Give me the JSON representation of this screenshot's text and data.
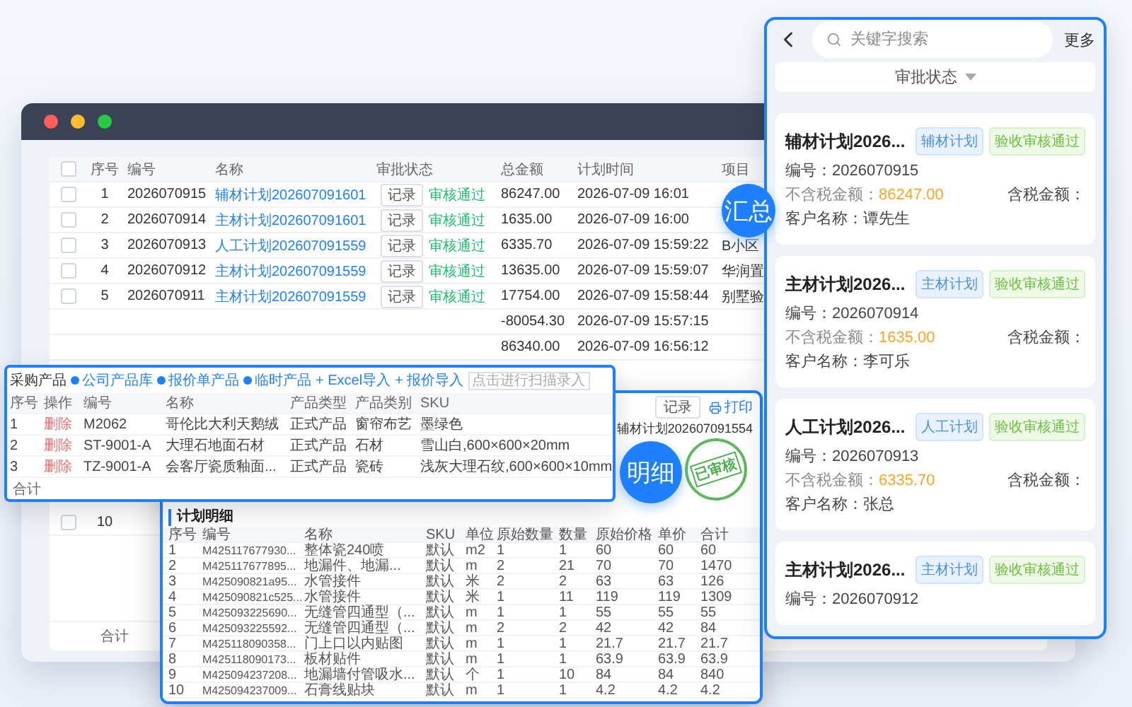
{
  "main_window": {
    "table": {
      "all_checked": false,
      "columns": [
        "序号",
        "编号",
        "名称",
        "审批状态",
        "总金额",
        "计划时间",
        "项目"
      ],
      "rows": [
        {
          "checked": false,
          "index": "1",
          "code": "2026070915",
          "name": "辅材计划202607091601",
          "record": "记录",
          "status": "审核通过",
          "amount": "86247.00",
          "time": "2026-07-09 16:01"
        },
        {
          "checked": false,
          "index": "2",
          "code": "2026070914",
          "name": "主材计划202607091601",
          "record": "记录",
          "status": "审核通过",
          "amount": "1635.00",
          "time": "2026-07-09 16:00"
        },
        {
          "checked": false,
          "index": "3",
          "code": "2026070913",
          "name": "人工计划202607091559",
          "record": "记录",
          "status": "审核通过",
          "amount": "6335.70",
          "time": "2026-07-09 15:59:22",
          "project": "B小区"
        },
        {
          "checked": false,
          "index": "4",
          "code": "2026070912",
          "name": "主材计划202607091559",
          "record": "记录",
          "status": "审核通过",
          "amount": "13635.00",
          "time": "2026-07-09 15:59:07",
          "project": "华润置"
        },
        {
          "checked": false,
          "index": "5",
          "code": "2026070911",
          "name": "主材计划202607091559",
          "record": "记录",
          "status": "审核通过",
          "amount": "17754.00",
          "time": "2026-07-09 15:58:44",
          "project": "别墅验"
        },
        {
          "amount": "-80054.30",
          "time": "2026-07-09 15:57:15"
        },
        {
          "amount": "86340.00",
          "time": "2026-07-09 16:56:12"
        }
      ],
      "last_row": {
        "checked": false,
        "index": "10"
      },
      "footer": "合计"
    }
  },
  "summary_badge": "汇总",
  "detail_badge": "明细",
  "product_popup": {
    "toolbar": [
      {
        "kind": "label",
        "text": "采购产品"
      },
      {
        "kind": "option",
        "text": "公司产品库"
      },
      {
        "kind": "option",
        "text": "报价单产品"
      },
      {
        "kind": "option",
        "text": "临时产品"
      },
      {
        "kind": "add",
        "text": "+ Excel导入"
      },
      {
        "kind": "add",
        "text": "+ 报价导入"
      }
    ],
    "scan_field": {
      "placeholder": "点击进行扫描录入"
    },
    "columns": [
      "序号",
      "操作",
      "编号",
      "名称",
      "产品类型",
      "产品类别",
      "SKU"
    ],
    "rows": [
      [
        "1",
        "删除",
        "M2062",
        "哥伦比大利天鹅绒",
        "正式产品",
        "窗帘布艺",
        "墨绿色"
      ],
      [
        "2",
        "删除",
        "ST-9001-A",
        "大理石地面石材",
        "正式产品",
        "石材",
        "雪山白,600×600×20mm"
      ],
      [
        "3",
        "删除",
        "TZ-9001-A",
        "会客厅瓷质釉面...",
        "正式产品",
        "瓷砖",
        "浅灰大理石纹,600×600×10mm"
      ]
    ],
    "footer": "合计"
  },
  "detail_panel": {
    "record_button": "记录",
    "print_link": "打印",
    "title": "辅材计划202607091554",
    "stamp": "已审核",
    "section": "计划明细",
    "columns": [
      "序号",
      "编号",
      "名称",
      "SKU",
      "单位",
      "原始数量",
      "数量",
      "原始价格",
      "单价",
      "合计"
    ],
    "rows": [
      [
        "1",
        "M425117677930...",
        "整体瓷240喷",
        "默认",
        "m2",
        "1",
        "1",
        "60",
        "60",
        "60"
      ],
      [
        "2",
        "M425117677895...",
        "地漏件、地漏...",
        "默认",
        "m",
        "2",
        "21",
        "70",
        "70",
        "1470"
      ],
      [
        "3",
        "M425090821a95...",
        "水管接件",
        "默认",
        "米",
        "2",
        "2",
        "63",
        "63",
        "126"
      ],
      [
        "4",
        "M425090821c525...",
        "水管接件",
        "默认",
        "米",
        "1",
        "11",
        "119",
        "119",
        "1309"
      ],
      [
        "5",
        "M425093225690...",
        "无缝管四通型（...",
        "默认",
        "m",
        "1",
        "1",
        "55",
        "55",
        "55"
      ],
      [
        "6",
        "M425093225592...",
        "无缝管四通型（...",
        "默认",
        "m",
        "2",
        "2",
        "42",
        "42",
        "84"
      ],
      [
        "7",
        "M425118090358...",
        "门上口以内贴图",
        "默认",
        "m",
        "1",
        "1",
        "21.7",
        "21.7",
        "21.7"
      ],
      [
        "8",
        "M425118090173...",
        "板材贴件",
        "默认",
        "m",
        "1",
        "1",
        "63.9",
        "63.9",
        "63.9"
      ],
      [
        "9",
        "M425094237208...",
        "地漏墙付管吸水...",
        "默认",
        "个",
        "1",
        "10",
        "84",
        "84",
        "840"
      ],
      [
        "10",
        "M425094237009...",
        "石膏线贴块",
        "默认",
        "m",
        "1",
        "1",
        "4.2",
        "4.2",
        "4.2"
      ]
    ]
  },
  "mobile": {
    "search": {
      "placeholder": "关键字搜索"
    },
    "more": "更多",
    "filter": "审批状态",
    "cards": [
      {
        "title": "辅材计划2026...",
        "tags": [
          {
            "kind": "type",
            "text": "辅材计划"
          },
          {
            "kind": "status",
            "text": "验收审核通过"
          }
        ],
        "code": "编号：2026070915",
        "net_label": "不含税金额：",
        "net_value": "86247.00",
        "gross_label": "含税金额：",
        "customer": "客户名称：谭先生"
      },
      {
        "title": "主材计划2026...",
        "tags": [
          {
            "kind": "type",
            "text": "主材计划"
          },
          {
            "kind": "status",
            "text": "验收审核通过"
          }
        ],
        "code": "编号：2026070914",
        "net_label": "不含税金额：",
        "net_value": "1635.00",
        "gross_label": "含税金额：",
        "customer": "客户名称：李可乐"
      },
      {
        "title": "人工计划2026...",
        "tags": [
          {
            "kind": "type",
            "text": "人工计划"
          },
          {
            "kind": "status",
            "text": "验收审核通过"
          }
        ],
        "code": "编号：2026070913",
        "net_label": "不含税金额：",
        "net_value": "6335.70",
        "gross_label": "含税金额：",
        "customer": "客户名称：张总"
      },
      {
        "title": "主材计划2026...",
        "tags": [
          {
            "kind": "type",
            "text": "主材计划"
          },
          {
            "kind": "status",
            "text": "验收审核通过"
          }
        ],
        "code": "编号：2026070912"
      }
    ]
  }
}
